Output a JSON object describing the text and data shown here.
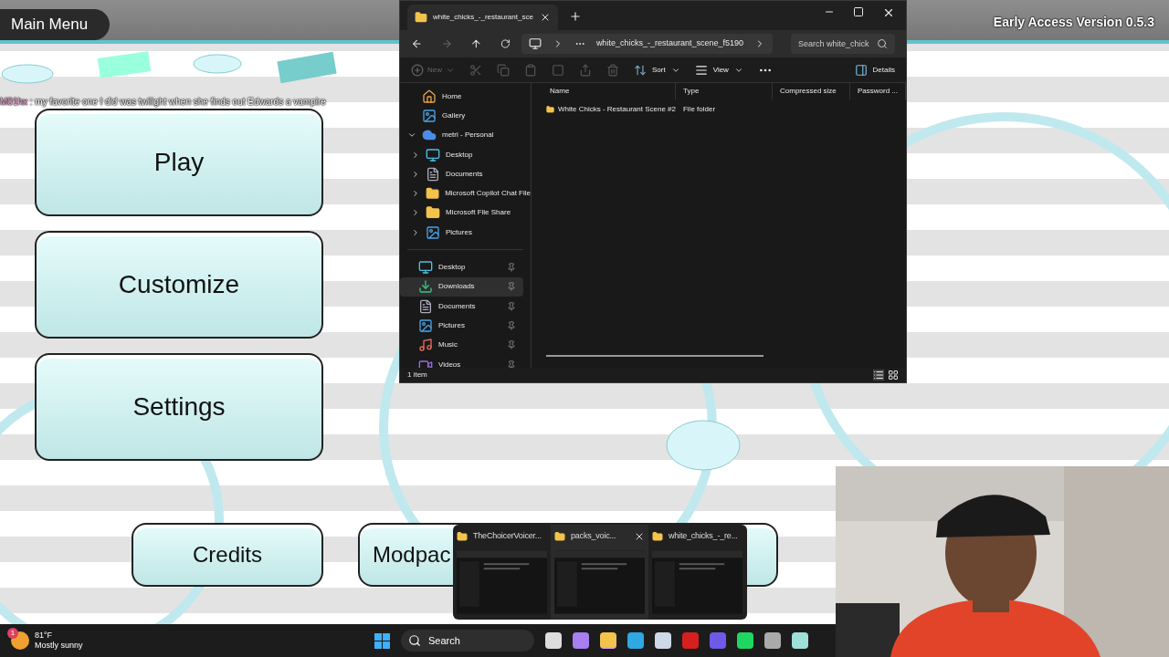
{
  "game": {
    "title": "Main Menu",
    "version": "Early Access Version 0.5.3",
    "chat": {
      "user": "M01hx",
      "message": ": my favorite one I did was twilight when she finds out Edwards a vampire"
    },
    "menu_buttons": [
      "Play",
      "Customize",
      "Settings"
    ],
    "bottom_buttons": [
      "Credits",
      "Modpac"
    ]
  },
  "explorer": {
    "tab": "white_chicks_-_restaurant_sce",
    "path": "white_chicks_-_restaurant_scene_f5190",
    "search": {
      "placeholder": "Search white_chick"
    },
    "toolbar": [
      {
        "label": "New",
        "disabled": true
      },
      {
        "label": "Sort",
        "disabled": false
      },
      {
        "label": "View",
        "disabled": false
      }
    ],
    "details": "Details",
    "tree": [
      {
        "label": "Home"
      },
      {
        "label": "Gallery"
      },
      {
        "label": "metri - Personal",
        "expanded": true,
        "children": [
          {
            "label": "Desktop",
            "expanded": false
          },
          {
            "label": "Documents",
            "expanded": false
          },
          {
            "label": "Microsoft Copilot Chat File",
            "expanded": false
          },
          {
            "label": "Microsoft File Share",
            "expanded": false
          },
          {
            "label": "Pictures",
            "expanded": false
          }
        ]
      }
    ],
    "pinned": [
      {
        "label": "Desktop",
        "selected": false
      },
      {
        "label": "Downloads",
        "selected": true
      },
      {
        "label": "Documents",
        "selected": false
      },
      {
        "label": "Pictures",
        "selected": false
      },
      {
        "label": "Music",
        "selected": false
      },
      {
        "label": "Videos",
        "selected": false
      }
    ],
    "columns": [
      "Name",
      "Type",
      "Compressed size",
      "Password ..."
    ],
    "rows": [
      {
        "name": "White Chicks - Restaurant Scene  #2",
        "type": "File folder"
      }
    ],
    "status": "1 item"
  },
  "thumbnails": [
    {
      "title": "TheChoicerVoicer...",
      "selected": false
    },
    {
      "title": "packs_voic...",
      "selected": true
    },
    {
      "title": "white_chicks_-_re...",
      "selected": false
    }
  ],
  "taskbar": {
    "temperature": "81°F",
    "weather": "Mostly sunny",
    "badge": "1",
    "search": "Search"
  }
}
